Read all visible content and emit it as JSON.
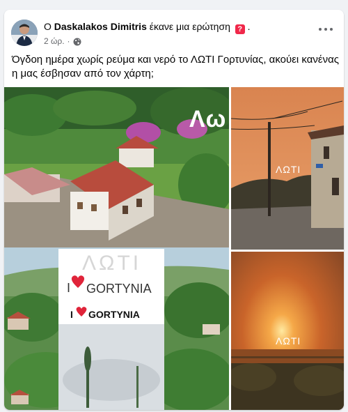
{
  "post": {
    "author_prefix": "Ο",
    "author_name": "Daskalakos Dimitris",
    "action": "έκανε μια ερώτηση",
    "question_mark_icon": "?",
    "suffix": ".",
    "time": "2 ώρ.",
    "separator": "·",
    "text": "Όγδοη ημέρα χωρίς ρεύμα και νερό το ΛΩΤΙ Γορτυνίας, ακούει κανένας η μας έσβησαν από τον χάρτη;"
  },
  "images": {
    "main": {
      "watermark_top": "Λω",
      "logo_word": "ΛΩΤΙ",
      "logo_i_love": "I",
      "logo_love_word": "GORTYNIA",
      "logo_i_love_bold": "I",
      "logo_love_word_bold": "GORTYNIA"
    },
    "top_right": {
      "watermark": "ΛΩΤΙ"
    },
    "bottom_right": {
      "watermark": "ΛΩΤΙ"
    }
  },
  "icons": {
    "more": "more-options-icon",
    "globe": "globe-icon",
    "question": "question-badge-icon"
  },
  "colors": {
    "accent_red": "#f0284a",
    "secondary_text": "#65676b",
    "fire_orange": "#d9783a"
  }
}
